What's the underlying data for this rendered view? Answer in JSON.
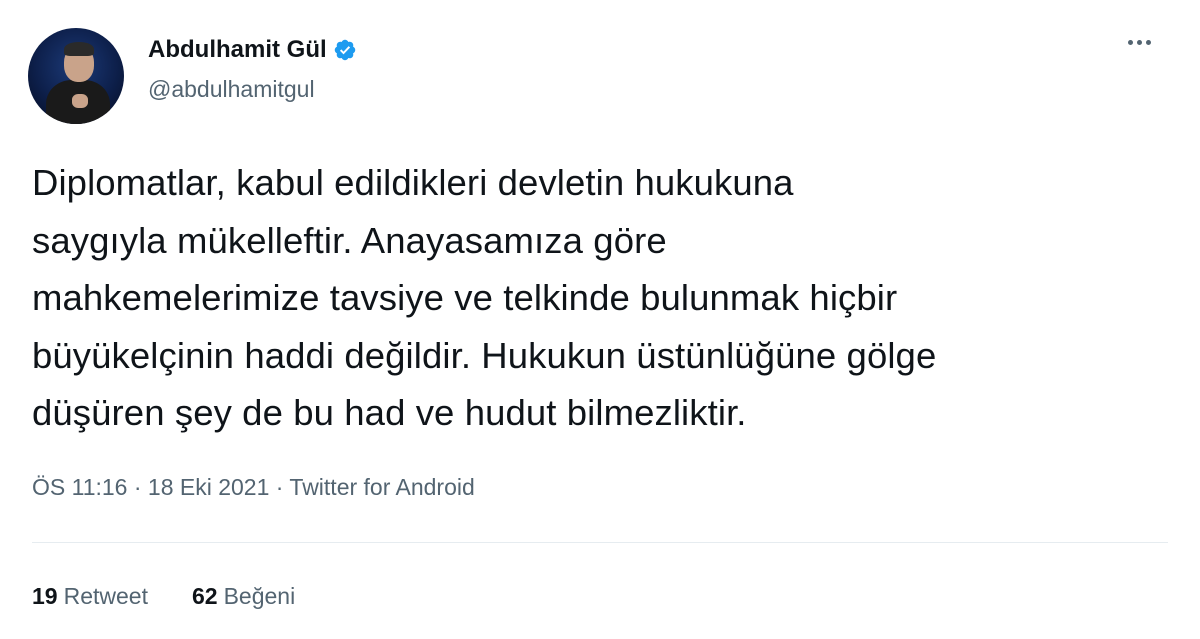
{
  "tweet": {
    "display_name": "Abdulhamit Gül",
    "handle": "@abdulhamitgul",
    "text": "Diplomatlar, kabul edildikleri devletin hukukuna\nsaygıyla mükelleftir. Anayasamıza göre\nmahkemelerimize tavsiye ve telkinde bulunmak hiçbir\nbüyükelçinin haddi değildir. Hukukun üstünlüğüne gölge\ndüşüren şey de bu had ve hudut bilmezliktir.",
    "meta": "ÖS 11:16 · 18 Eki 2021 · Twitter for Android",
    "retweets": {
      "count": "19",
      "label": "Retweet"
    },
    "likes": {
      "count": "62",
      "label": "Beğeni"
    }
  },
  "icons": {
    "verified": "verified-badge-icon",
    "more": "more-options-icon"
  },
  "colors": {
    "verified": "#1d9bf0",
    "secondary_text": "#536471",
    "primary_text": "#0f1419"
  }
}
